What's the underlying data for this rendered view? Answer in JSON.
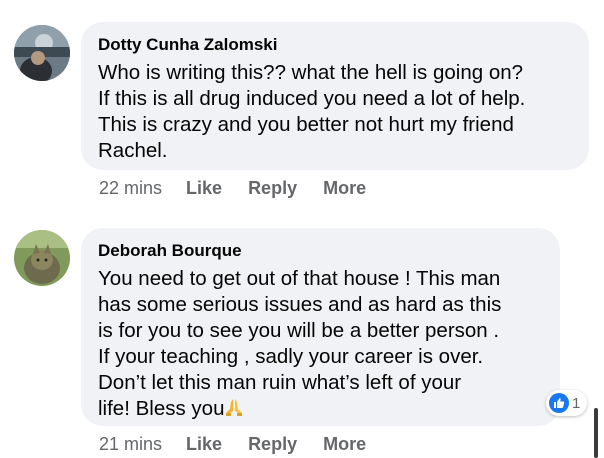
{
  "comments": [
    {
      "author": "Dotty Cunha Zalomski",
      "text": "Who is writing this?? what the hell is going on?\nIf this is all drug induced you need a lot of help.\nThis is crazy and you better not hurt my friend\nRachel.",
      "time": "22 mins",
      "like_label": "Like",
      "reply_label": "Reply",
      "more_label": "More"
    },
    {
      "author": "Deborah Bourque",
      "text": "You need to get out of that house ! This man\nhas some serious issues and as hard as this\nis for you to see you will be a better person .\nIf your teaching , sadly your career is over.\nDon’t let this man ruin what’s left of your\nlife! Bless you",
      "emoji": "folded-hands-icon",
      "time": "21 mins",
      "like_label": "Like",
      "reply_label": "Reply",
      "more_label": "More",
      "reaction_count": "1"
    }
  ],
  "colors": {
    "bubble": "#f0f2f5",
    "name": "#050505",
    "meta": "#65676b",
    "like_blue": "#1877f2"
  }
}
